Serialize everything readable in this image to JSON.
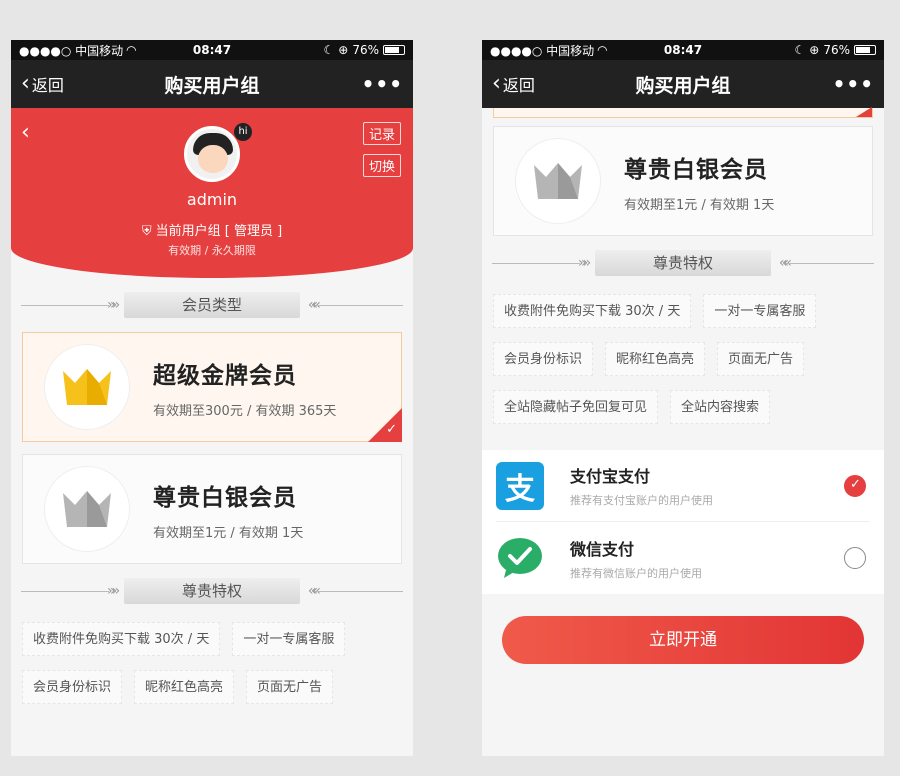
{
  "status_bar": {
    "carrier": "●●●●○ 中国移动",
    "time": "08:47",
    "battery": "76%"
  },
  "nav": {
    "back_label": "返回",
    "title": "购买用户组",
    "more_label": "•••"
  },
  "profile": {
    "record_btn": "记录",
    "switch_btn": "切换",
    "hi_badge": "hi",
    "username": "admin",
    "current_group": "当前用户组 [ 管理员 ]",
    "validity": "有效期 / 永久期限"
  },
  "sections": {
    "member_type": "会员类型",
    "privileges": "尊贵特权"
  },
  "members": [
    {
      "name": "超级金牌会员",
      "desc": "有效期至300元 / 有效期 365天",
      "crown_color": "#f5c11a",
      "selected": true
    },
    {
      "name": "尊贵白银会员",
      "desc": "有效期至1元 / 有效期 1天",
      "crown_color": "#a9a9a9",
      "selected": false
    }
  ],
  "perks": [
    "收费附件免购买下载 30次 / 天",
    "一对一专属客服",
    "会员身份标识",
    "昵称红色高亮",
    "页面无广告",
    "全站隐藏帖子免回复可见",
    "全站内容搜索"
  ],
  "payment": [
    {
      "title": "支付宝支付",
      "sub": "推荐有支付宝账户的用户使用",
      "icon": "alipay-icon",
      "icon_char": "支",
      "selected": true
    },
    {
      "title": "微信支付",
      "sub": "推荐有微信账户的用户使用",
      "icon": "wechat-icon",
      "selected": false
    }
  ],
  "open_button": "立即开通",
  "colors": {
    "brand_red": "#e63f3f",
    "gold": "#f5c11a",
    "silver": "#a9a9a9",
    "alipay_blue": "#1a9fe0",
    "wechat_green": "#2aae67"
  }
}
